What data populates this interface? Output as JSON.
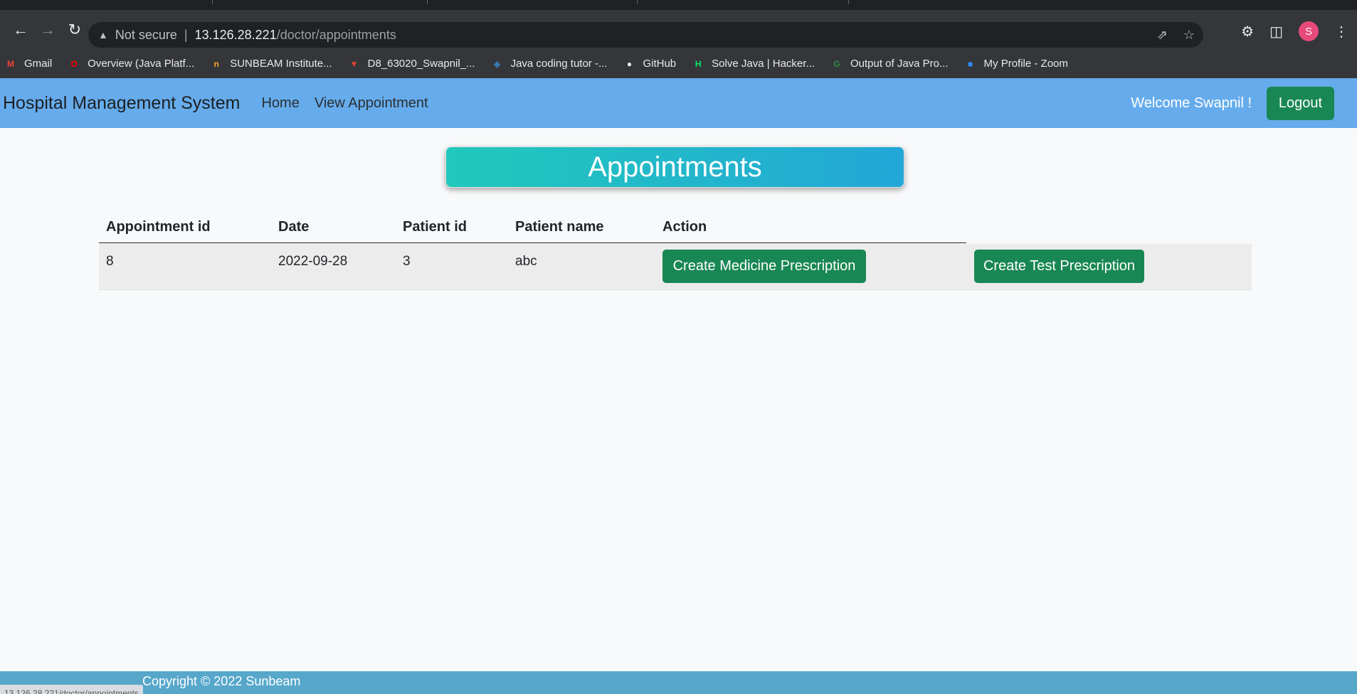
{
  "browser": {
    "url_warning": "Not secure",
    "url_host": "13.126.28.221",
    "url_path": "/doctor/appointments",
    "profile_initial": "S",
    "status_url": "13.126.28.221/doctor/appointments"
  },
  "bookmarks": [
    {
      "label": "Gmail",
      "icon": "gmail-icon",
      "color": "#ea4335"
    },
    {
      "label": "Overview (Java Platf...",
      "icon": "oracle-icon",
      "color": "#f80000"
    },
    {
      "label": "SUNBEAM Institute...",
      "icon": "sunbeam-icon",
      "color": "#f5a623"
    },
    {
      "label": "D8_63020_Swapnil_...",
      "icon": "gitlab-icon",
      "color": "#e24329"
    },
    {
      "label": "Java coding tutor -...",
      "icon": "python-icon",
      "color": "#3776ab"
    },
    {
      "label": "GitHub",
      "icon": "github-icon",
      "color": "#e8eaed"
    },
    {
      "label": "Solve Java | Hacker...",
      "icon": "hackerrank-icon",
      "color": "#00ea64"
    },
    {
      "label": "Output of Java Pro...",
      "icon": "geeksforgeeks-icon",
      "color": "#2f8d46"
    },
    {
      "label": "My Profile - Zoom",
      "icon": "zoom-icon",
      "color": "#2d8cff"
    }
  ],
  "nav": {
    "brand": "Hospital Management System",
    "home": "Home",
    "view_appointment": "View Appointment",
    "welcome": "Welcome Swapnil !",
    "logout": "Logout"
  },
  "page": {
    "title": "Appointments"
  },
  "table": {
    "headers": [
      "Appointment id",
      "Date",
      "Patient id",
      "Patient name",
      "Action"
    ],
    "rows": [
      {
        "id": "8",
        "date": "2022-09-28",
        "patient_id": "3",
        "patient_name": "abc",
        "action_medicine": "Create Medicine Prescription",
        "action_test": "Create Test Prescription"
      }
    ]
  },
  "footer": {
    "copyright": "Copyright © 2022 Sunbeam"
  },
  "colors": {
    "navbar": "#66acec",
    "button": "#198754",
    "footer": "#57a7cb"
  }
}
